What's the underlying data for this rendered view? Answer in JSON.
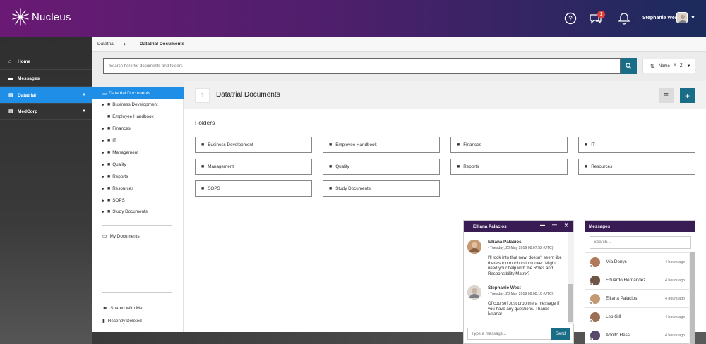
{
  "header": {
    "logo_text": "Nucleus",
    "notification_count": "1",
    "user_name": "Stephanie West"
  },
  "leftnav": {
    "items": [
      {
        "label": "Home",
        "icon": "home-icon"
      },
      {
        "label": "Messages",
        "icon": "chat-icon"
      },
      {
        "label": "Datatrial",
        "icon": "building-icon"
      },
      {
        "label": "MedCorp",
        "icon": "building-icon"
      }
    ]
  },
  "breadcrumb": {
    "parent": "Datatrial",
    "current": "Datatrial Documents"
  },
  "search": {
    "placeholder": "Search here for documents and folders",
    "sort_label": "Name - A - Z"
  },
  "tree": {
    "root": "Datatrial Documents",
    "items": [
      {
        "label": "Business Development",
        "has_children": true
      },
      {
        "label": "Employee Handbook",
        "has_children": false
      },
      {
        "label": "Finances",
        "has_children": true
      },
      {
        "label": "IT",
        "has_children": true
      },
      {
        "label": "Management",
        "has_children": true
      },
      {
        "label": "Quality",
        "has_children": true
      },
      {
        "label": "Reports",
        "has_children": true
      },
      {
        "label": "Resources",
        "has_children": true
      },
      {
        "label": "SOPS",
        "has_children": true
      },
      {
        "label": "Study Documents",
        "has_children": true
      }
    ],
    "my_documents": "My Documents",
    "shared_with_me": "Shared With Me",
    "recently_deleted": "Recently Deleted"
  },
  "main": {
    "title": "Datatrial Documents",
    "doc_icon_text": "?",
    "folders_label": "Folders",
    "folders": [
      "Business Development",
      "Employee Handbook",
      "Finances",
      "IT",
      "Management",
      "Quality",
      "Reports",
      "Resources",
      "SOPS",
      "Study Documents"
    ]
  },
  "chat": {
    "title": "Elliana Palacios",
    "messages": [
      {
        "name": "Elliana Palacios",
        "time": "- Tuesday, 28 May 2019 08:07:52 (UTC)",
        "text": "I'll look into that now, doesn't seem like there's too much to look over. Might need your help with the Roles and Responsibility Matrix?"
      },
      {
        "name": "Stephanie West",
        "time": "- Tuesday, 28 May 2019 08:08:16 (UTC)",
        "text": "Of course! Just drop me a message if you have any questions. Thanks Elliana!"
      }
    ],
    "input_placeholder": "Type a message...",
    "send_label": "Send"
  },
  "messages_panel": {
    "title": "Messages",
    "search_placeholder": "Search...",
    "contacts": [
      {
        "name": "Mia Denys",
        "time": "4 hours ago"
      },
      {
        "name": "Eduardo Hernandez",
        "time": "4 hours ago"
      },
      {
        "name": "Elliana Palacios",
        "time": "4 hours ago"
      },
      {
        "name": "Leo Gill",
        "time": "4 hours ago"
      },
      {
        "name": "Adolfo Hess",
        "time": "4 hours ago"
      }
    ]
  }
}
